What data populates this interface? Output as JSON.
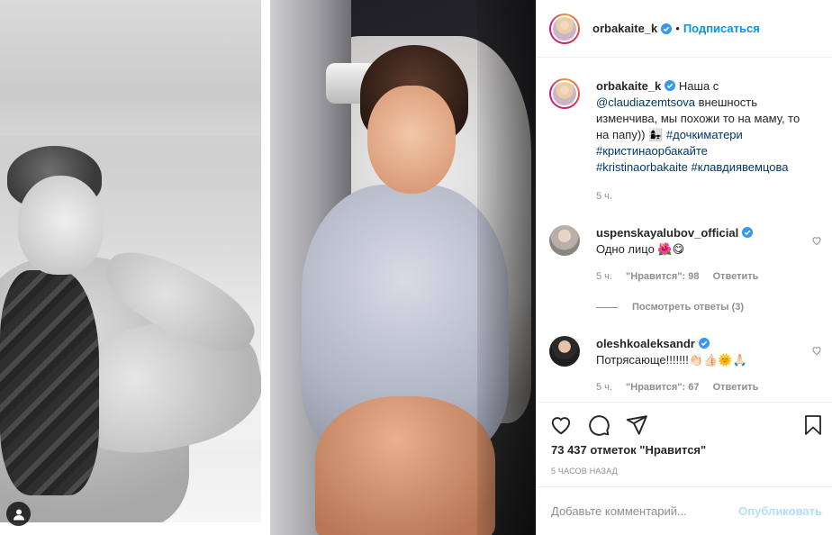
{
  "post": {
    "username": "orbakaite_k",
    "follow_label": "Подписаться",
    "dot": "•"
  },
  "caption": {
    "username": "orbakaite_k",
    "text_1": "Наша с ",
    "mention": "@claudiazemtsova",
    "text_2": " внешность изменчива, мы похожи то на маму, то на папу)) 👩‍👧 ",
    "tag_1": "#дочкиматери",
    "tag_2": "#кристинаорбакайте",
    "tag_3": "#kristinaorbakaite",
    "tag_4": "#клавдиявемцова",
    "time": "5 ч."
  },
  "comments": [
    {
      "username": "uspenskayalubov_official",
      "text": "Одно лицо 🌺😋",
      "time": "5 ч.",
      "likes": "\"Нравится\": 98",
      "reply": "Ответить"
    },
    {
      "username": "oleshkoaleksandr",
      "text": "Потрясающе!!!!!!!👏🏻👍🏻🌞🙏🏻",
      "time": "5 ч.",
      "likes": "\"Нравится\": 67",
      "reply": "Ответить"
    }
  ],
  "view_replies": "Посмотреть ответы (3)",
  "likes_count": "73 437 отметок \"Нравится\"",
  "posted_ago": "5 ЧАСОВ НАЗАД",
  "add_comment": {
    "placeholder": "Добавьте комментарий...",
    "publish_label": "Опубликовать"
  },
  "colors": {
    "accent": "#0095f6",
    "publish_disabled": "#b2dffc",
    "muted": "#8e8e8e",
    "verified": "#3897f0"
  },
  "icons": [
    "verified-icon",
    "heart-icon",
    "comment-icon",
    "share-icon",
    "bookmark-icon",
    "tag-user-icon"
  ]
}
